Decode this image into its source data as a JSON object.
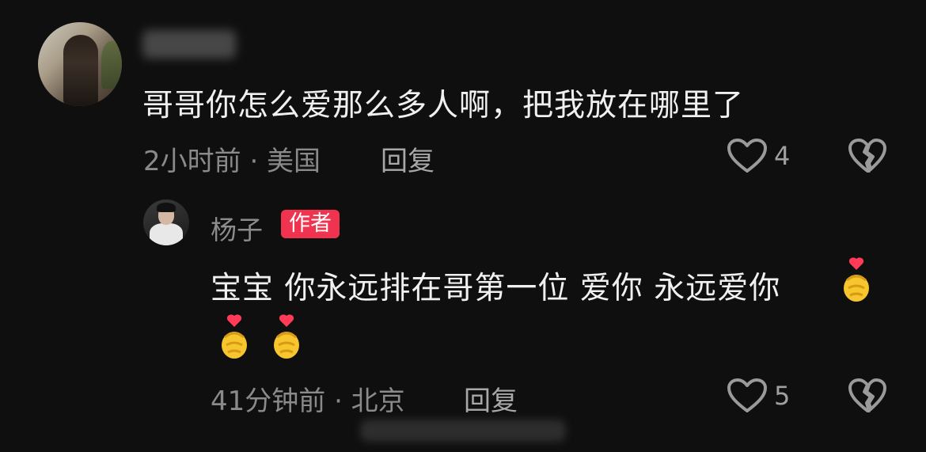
{
  "comment": {
    "text": "哥哥你怎么爱那么多人啊，把我放在哪里了",
    "meta": "2小时前 · 美国",
    "reply_label": "回复",
    "like_count": "4"
  },
  "reply": {
    "author_name": "杨子",
    "author_badge": "作者",
    "text_line1": "宝宝 你永远排在哥第一位 爱你 永远爱你",
    "meta": "41分钟前 · 北京",
    "reply_label": "回复",
    "like_count": "5"
  },
  "icons": [
    "heart-icon",
    "broken-heart-icon",
    "finger-heart-emoji"
  ],
  "colors": {
    "background": "#0f0f0f",
    "badge": "#f0334f",
    "text": "#f0f0f0",
    "muted": "#8a8a8a"
  }
}
